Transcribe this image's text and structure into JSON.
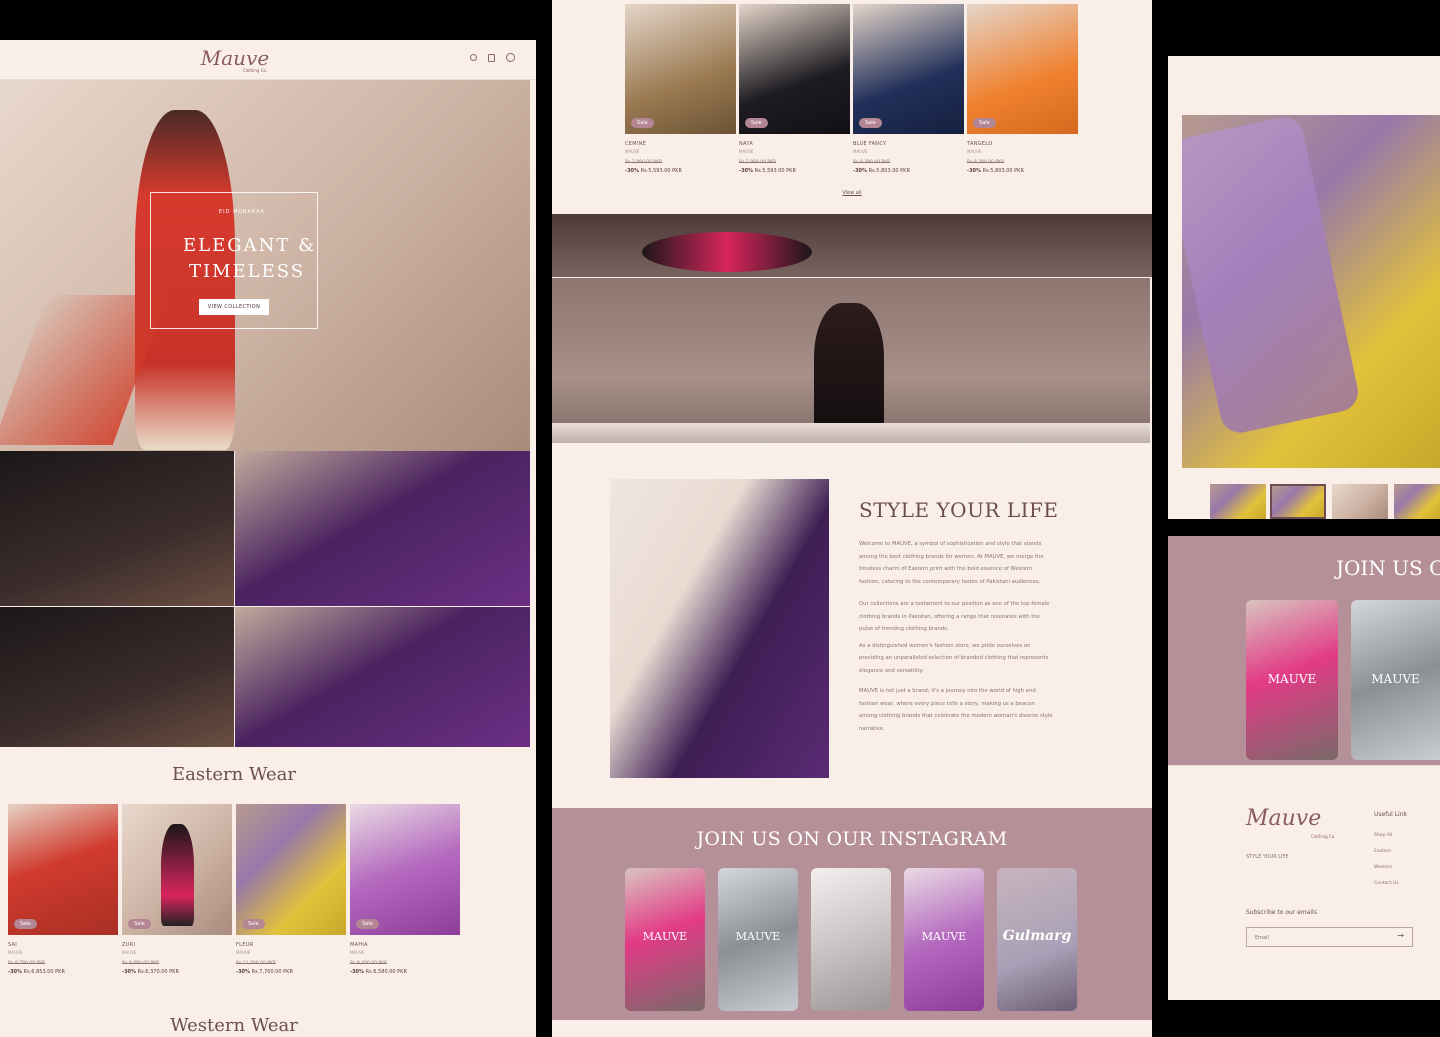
{
  "brand": {
    "name": "Mauve",
    "tagline": "Clothing Co."
  },
  "colors": {
    "bg": "#faefe8",
    "accent": "#b48593",
    "text": "#6b4d52",
    "instagram_bg": "#b69099"
  },
  "header": {
    "icons": [
      "search-icon",
      "bag-icon",
      "whatsapp-icon"
    ]
  },
  "hero": {
    "kicker": "EID MUBARAK",
    "title_line1": "ELEGANT &",
    "title_line2": "TIMELESS",
    "cta": "VIEW COLLECTION"
  },
  "eastern": {
    "heading": "Eastern Wear",
    "products": [
      {
        "name": "SAI",
        "sub": "MAUVE",
        "old": "Rs.9,790.00 PKR",
        "discount": "-30%",
        "price": "Rs.6,853.00 PKR",
        "sale": "Sale"
      },
      {
        "name": "ZURI",
        "sub": "MAUVE",
        "old": "Rs.9,090.00 PKR",
        "discount": "-30%",
        "price": "Rs.6,370.00 PKR",
        "sale": "Sale"
      },
      {
        "name": "FLEUR",
        "sub": "MAUVE",
        "old": "Rs.11,000.00 PKR",
        "discount": "-30%",
        "price": "Rs.7,700.00 PKR",
        "sale": "Sale"
      },
      {
        "name": "MAHIA",
        "sub": "MAUVE",
        "old": "Rs.9,400.00 PKR",
        "discount": "-30%",
        "price": "Rs.6,580.00 PKR",
        "sale": "Sale"
      }
    ]
  },
  "western": {
    "heading": "Western Wear"
  },
  "western_products": [
    {
      "name": "CEMINE",
      "sub": "MAUVE",
      "old": "Rs.7,990.00 PKR",
      "discount": "-30%",
      "price": "Rs.5,593.00 PKR",
      "sale": "Sale"
    },
    {
      "name": "NAYA",
      "sub": "MAUVE",
      "old": "Rs.7,990.00 PKR",
      "discount": "-30%",
      "price": "Rs.5,593.00 PKR",
      "sale": "Sale"
    },
    {
      "name": "BLUE FANCY",
      "sub": "MAUVE",
      "old": "Rs.8,290.00 PKR",
      "discount": "-30%",
      "price": "Rs.5,803.00 PKR",
      "sale": "Sale"
    },
    {
      "name": "TANGELO",
      "sub": "MAUVE",
      "old": "Rs.8,290.00 PKR",
      "discount": "-30%",
      "price": "Rs.5,803.00 PKR",
      "sale": "Sale"
    }
  ],
  "view_all": "View all",
  "style": {
    "heading": "STYLE YOUR LIFE",
    "p1": "Welcome to MAUVE, a symbol of sophistication and style that stands among the best clothing brands for women. At MAUVE, we merge the timeless charm of Eastern print with the bold essence of Western fashion, catering to the contemporary tastes of Pakistani audiences.",
    "p2": "Our collections are a testament to our position as one of the top female clothing brands in Pakistan, offering a range that resonates with the pulse of trending clothing brands.",
    "p3": "As a distinguished women's fashion store, we pride ourselves on providing an unparalleled selection of branded clothing that represents elegance and versatility.",
    "p4": "MAUVE is not just a brand; it's a journey into the world of high end fashion wear, where every piece tells a story, making us a beacon among clothing brands that celebrate the modern woman's diverse style narrative."
  },
  "instagram": {
    "heading": "JOIN US ON OUR INSTAGRAM",
    "heading_cropped": "JOIN US O",
    "overlay": "MAUVE",
    "overlay_alt": "Gulmarg"
  },
  "footer": {
    "tagline": "STYLE YOUR LIFE",
    "links_title": "Useful Link",
    "links": [
      "Shop All",
      "Eastern",
      "Western",
      "Contact Us"
    ],
    "subscribe": "Subscribe to our emails",
    "email_placeholder": "Email"
  }
}
